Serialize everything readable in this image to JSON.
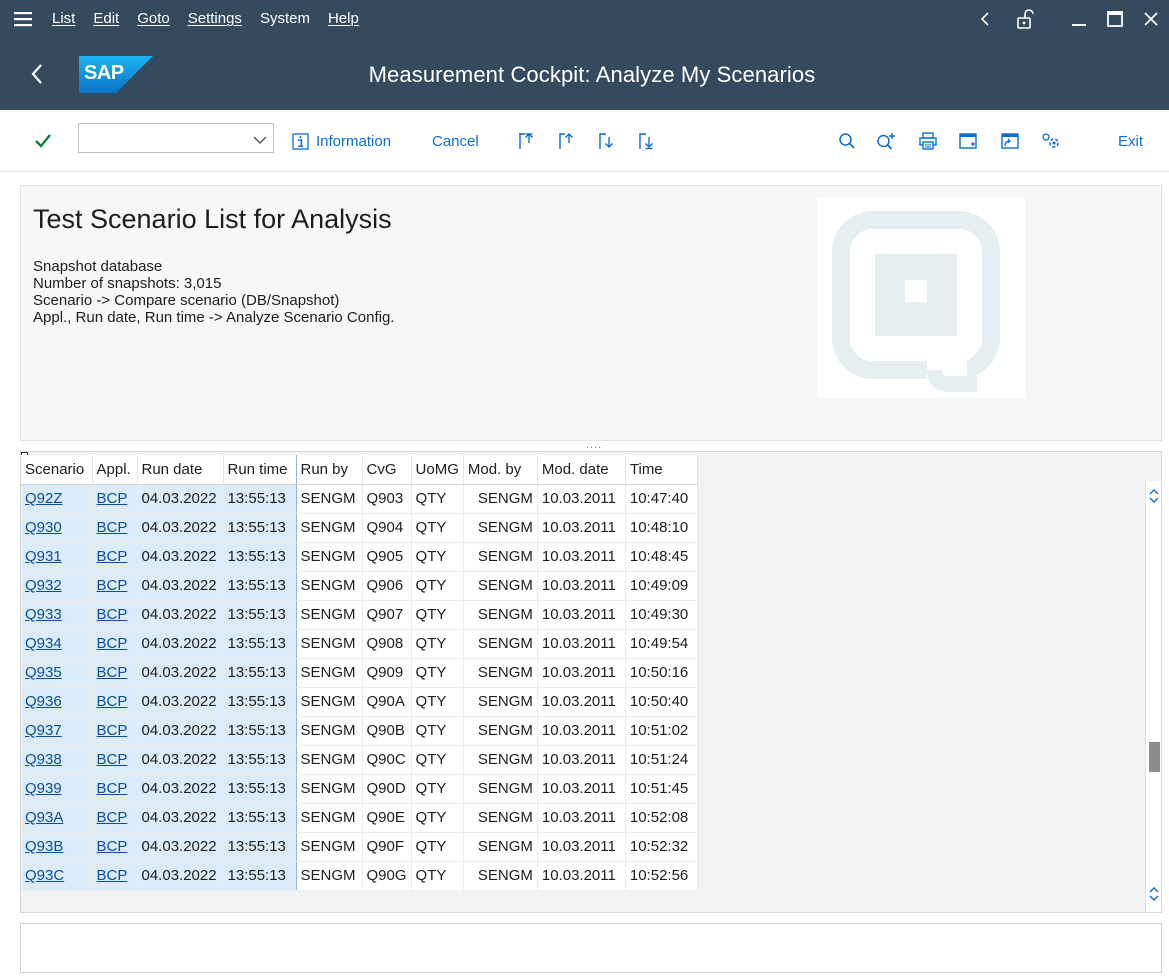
{
  "menubar": {
    "items": [
      "List",
      "Edit",
      "Goto",
      "Settings",
      "System",
      "Help"
    ]
  },
  "titlebar": {
    "logo_text": "SAP",
    "title": "Measurement Cockpit: Analyze My Scenarios"
  },
  "toolbar": {
    "command_field_value": "",
    "information_label": "Information",
    "cancel_label": "Cancel",
    "exit_label": "Exit"
  },
  "header": {
    "title": "Test Scenario List for Analysis",
    "lines": [
      "Snapshot database",
      "Number of snapshots: 3,015",
      "Scenario -> Compare scenario (DB/Snapshot)",
      "Appl., Run date, Run time -> Analyze Scenario Config."
    ]
  },
  "splitter": {
    "dots": "...."
  },
  "table": {
    "columns": [
      "Scenario",
      "Appl.",
      "Run date",
      "Run time",
      "Run by",
      "CvG",
      "UoMG",
      "Mod. by",
      "Mod. date",
      "Time"
    ],
    "rows": [
      [
        "Q92Z",
        "BCP",
        "04.03.2022",
        "13:55:13",
        "SENGM",
        "Q903",
        "QTY",
        "SENGM",
        "10.03.2011",
        "10:47:40"
      ],
      [
        "Q930",
        "BCP",
        "04.03.2022",
        "13:55:13",
        "SENGM",
        "Q904",
        "QTY",
        "SENGM",
        "10.03.2011",
        "10:48:10"
      ],
      [
        "Q931",
        "BCP",
        "04.03.2022",
        "13:55:13",
        "SENGM",
        "Q905",
        "QTY",
        "SENGM",
        "10.03.2011",
        "10:48:45"
      ],
      [
        "Q932",
        "BCP",
        "04.03.2022",
        "13:55:13",
        "SENGM",
        "Q906",
        "QTY",
        "SENGM",
        "10.03.2011",
        "10:49:09"
      ],
      [
        "Q933",
        "BCP",
        "04.03.2022",
        "13:55:13",
        "SENGM",
        "Q907",
        "QTY",
        "SENGM",
        "10.03.2011",
        "10:49:30"
      ],
      [
        "Q934",
        "BCP",
        "04.03.2022",
        "13:55:13",
        "SENGM",
        "Q908",
        "QTY",
        "SENGM",
        "10.03.2011",
        "10:49:54"
      ],
      [
        "Q935",
        "BCP",
        "04.03.2022",
        "13:55:13",
        "SENGM",
        "Q909",
        "QTY",
        "SENGM",
        "10.03.2011",
        "10:50:16"
      ],
      [
        "Q936",
        "BCP",
        "04.03.2022",
        "13:55:13",
        "SENGM",
        "Q90A",
        "QTY",
        "SENGM",
        "10.03.2011",
        "10:50:40"
      ],
      [
        "Q937",
        "BCP",
        "04.03.2022",
        "13:55:13",
        "SENGM",
        "Q90B",
        "QTY",
        "SENGM",
        "10.03.2011",
        "10:51:02"
      ],
      [
        "Q938",
        "BCP",
        "04.03.2022",
        "13:55:13",
        "SENGM",
        "Q90C",
        "QTY",
        "SENGM",
        "10.03.2011",
        "10:51:24"
      ],
      [
        "Q939",
        "BCP",
        "04.03.2022",
        "13:55:13",
        "SENGM",
        "Q90D",
        "QTY",
        "SENGM",
        "10.03.2011",
        "10:51:45"
      ],
      [
        "Q93A",
        "BCP",
        "04.03.2022",
        "13:55:13",
        "SENGM",
        "Q90E",
        "QTY",
        "SENGM",
        "10.03.2011",
        "10:52:08"
      ],
      [
        "Q93B",
        "BCP",
        "04.03.2022",
        "13:55:13",
        "SENGM",
        "Q90F",
        "QTY",
        "SENGM",
        "10.03.2011",
        "10:52:32"
      ],
      [
        "Q93C",
        "BCP",
        "04.03.2022",
        "13:55:13",
        "SENGM",
        "Q90G",
        "QTY",
        "SENGM",
        "10.03.2011",
        "10:52:56"
      ]
    ]
  },
  "statusbar": {
    "message": ""
  },
  "colors": {
    "shell": "#354a5f",
    "accent_blue": "#0a6ed1",
    "ok_green": "#107e3e",
    "key_column_bg": "#dcebf8"
  },
  "icons": {
    "menu": "hamburger-icon",
    "back": "back-arrow-icon",
    "ok": "checkmark-icon",
    "info": "information-icon",
    "first_page": "first-page-icon",
    "prev_page": "previous-page-icon",
    "next_page": "next-page-icon",
    "last_page": "last-page-icon",
    "find": "search-icon",
    "find_next": "search-next-icon",
    "print": "print-icon",
    "new_session": "new-session-icon",
    "shortcut": "create-shortcut-icon",
    "customize": "customize-layout-icon"
  }
}
